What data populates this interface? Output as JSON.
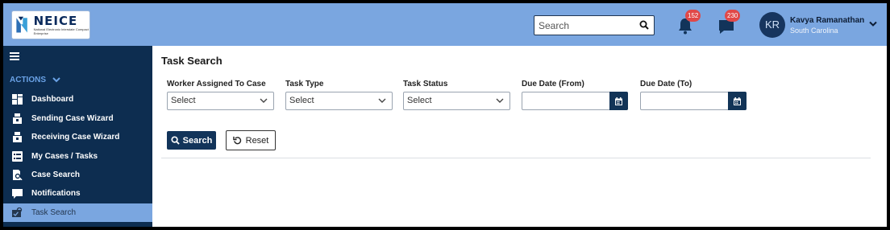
{
  "header": {
    "logo_title": "NEICE",
    "logo_subtitle": "National Electronic Interstate Compact Enterprise",
    "search_placeholder": "Search",
    "notifications_count": "152",
    "messages_count": "230",
    "user_initials": "KR",
    "user_name": "Kavya Ramanathan",
    "user_state": "South Carolina"
  },
  "sidebar": {
    "actions_label": "ACTIONS",
    "items": [
      {
        "label": "Dashboard",
        "icon": "dashboard-icon"
      },
      {
        "label": "Sending Case Wizard",
        "icon": "sending-case-icon"
      },
      {
        "label": "Receiving Case Wizard",
        "icon": "receiving-case-icon"
      },
      {
        "label": "My Cases / Tasks",
        "icon": "list-icon"
      },
      {
        "label": "Case Search",
        "icon": "case-search-icon"
      },
      {
        "label": "Notifications",
        "icon": "chat-icon"
      },
      {
        "label": "Task Search",
        "icon": "task-search-icon",
        "active": true
      }
    ]
  },
  "main": {
    "title": "Task Search",
    "filters": {
      "worker_label": "Worker Assigned To Case",
      "worker_value": "Select",
      "task_type_label": "Task Type",
      "task_type_value": "Select",
      "task_status_label": "Task Status",
      "task_status_value": "Select",
      "due_from_label": "Due Date (From)",
      "due_to_label": "Due Date (To)"
    },
    "search_button": "Search",
    "reset_button": "Reset"
  },
  "colors": {
    "header_bg": "#7aa6e0",
    "sidebar_bg": "#0d2d50",
    "primary_button": "#12345a",
    "badge": "#e04848",
    "active_nav": "#7aa6e0"
  }
}
